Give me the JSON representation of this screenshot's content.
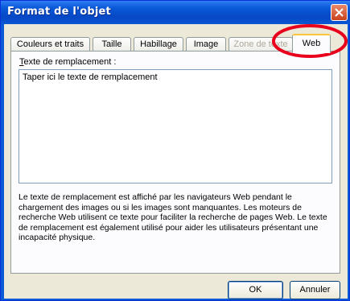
{
  "window": {
    "title": "Format de l'objet"
  },
  "tabs": [
    {
      "label": "Couleurs et traits"
    },
    {
      "label": "Taille"
    },
    {
      "label": "Habillage"
    },
    {
      "label": "Image"
    },
    {
      "label": "Zone de texte",
      "disabled": true
    },
    {
      "label": "Web",
      "active": true
    }
  ],
  "web_tab": {
    "field_label_underlined": "T",
    "field_label_rest": "exte de remplacement :",
    "alt_text_value": "Taper ici le texte de remplacement",
    "help_text": "Le texte de remplacement est affiché par les navigateurs Web pendant le chargement des images ou si les images sont manquantes. Les moteurs de recherche Web utilisent ce texte pour faciliter la recherche de pages Web. Le texte de remplacement est également utilisé pour aider les utilisateurs présentant une incapacité physique."
  },
  "buttons": {
    "ok": "OK",
    "cancel": "Annuler"
  },
  "annotation": {
    "shape": "ellipse",
    "color": "#e8001c",
    "target": "Web"
  },
  "colors": {
    "titlebar": "#0a5ad8",
    "dialog_bg": "#ece9d8",
    "active_tab_highlight": "#ffc73c"
  }
}
